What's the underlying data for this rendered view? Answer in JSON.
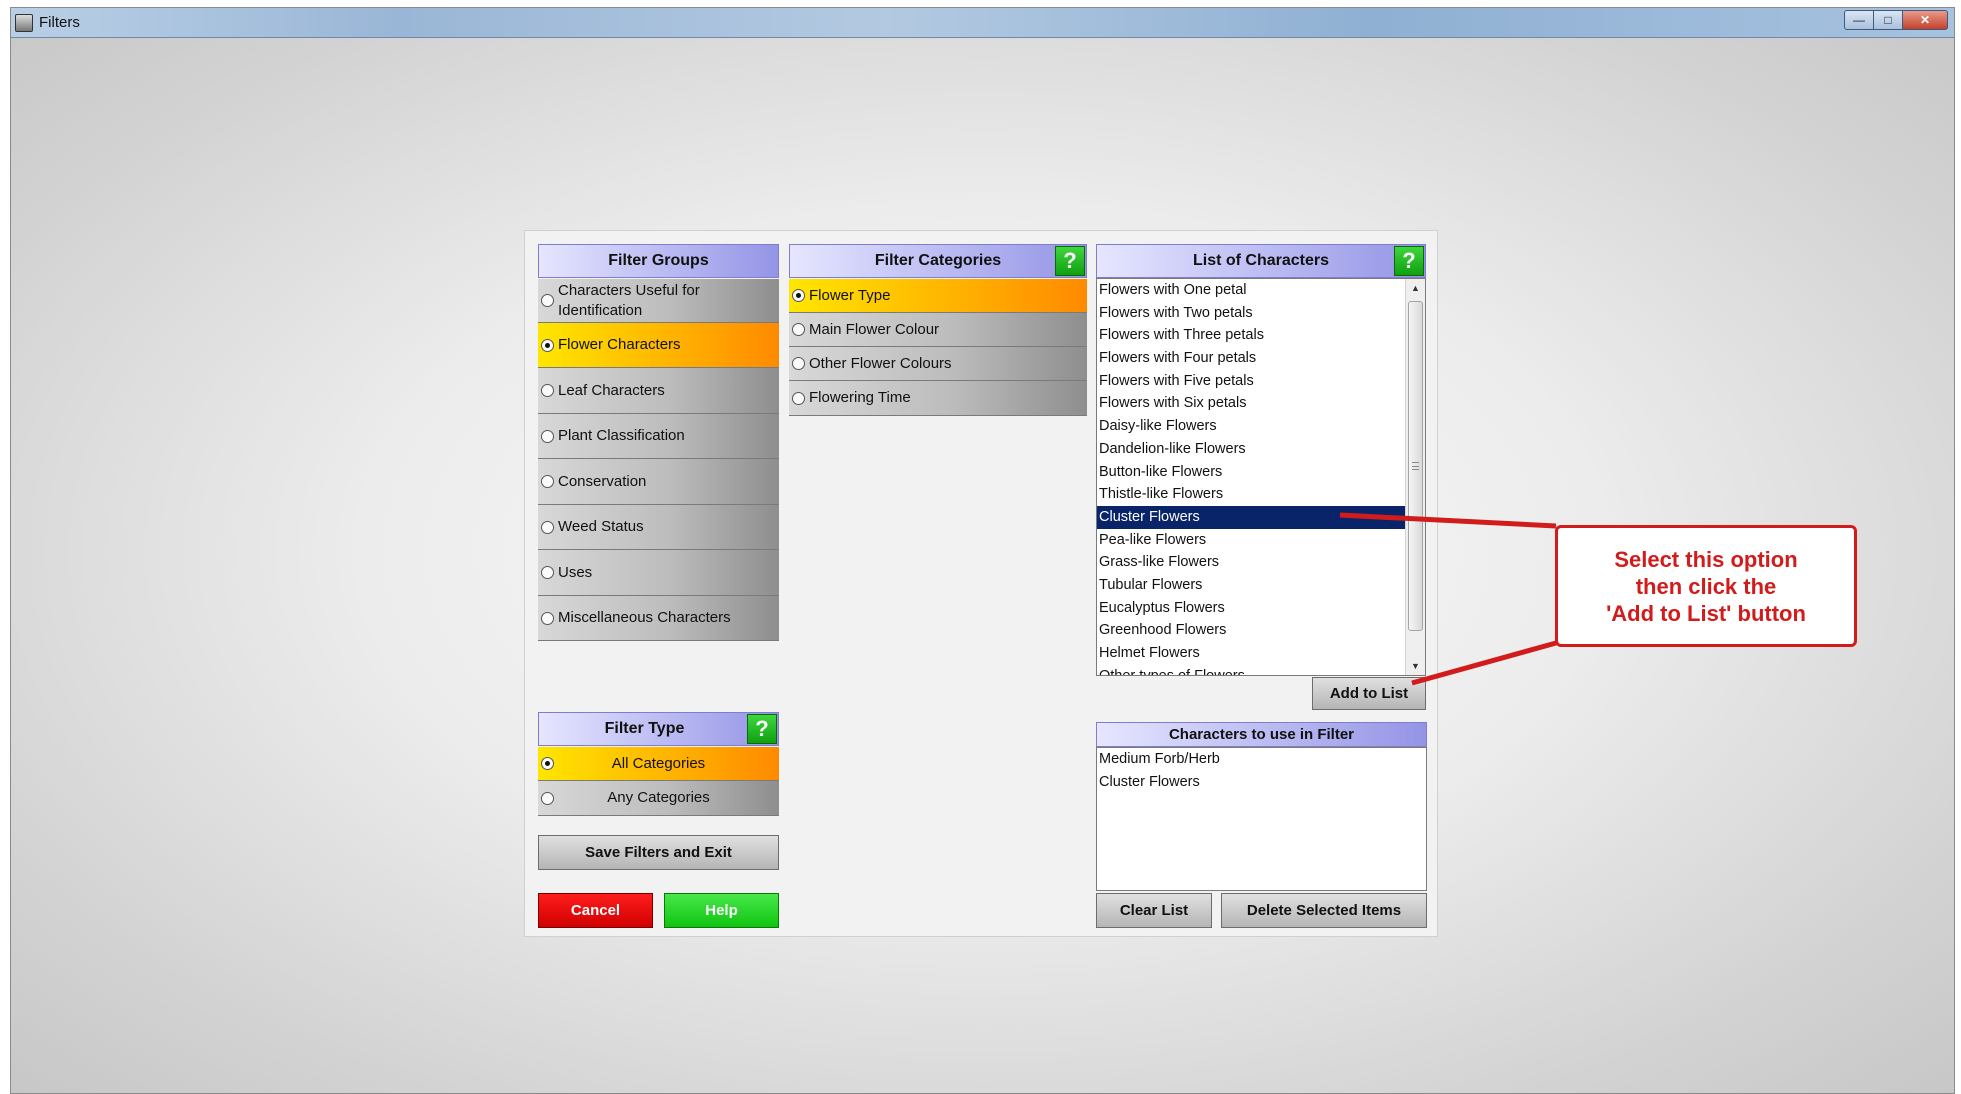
{
  "window": {
    "title": "Filters",
    "controls": [
      "minimize",
      "maximize",
      "close"
    ]
  },
  "filter_groups": {
    "header": "Filter Groups",
    "items": [
      {
        "label": "Characters Useful for Identification",
        "selected": false
      },
      {
        "label": "Flower Characters",
        "selected": true
      },
      {
        "label": "Leaf Characters",
        "selected": false
      },
      {
        "label": "Plant Classification",
        "selected": false
      },
      {
        "label": "Conservation",
        "selected": false
      },
      {
        "label": "Weed Status",
        "selected": false
      },
      {
        "label": "Uses",
        "selected": false
      },
      {
        "label": "Miscellaneous Characters",
        "selected": false
      }
    ]
  },
  "filter_categories": {
    "header": "Filter Categories",
    "help_label": "?",
    "items": [
      {
        "label": "Flower Type",
        "selected": true
      },
      {
        "label": "Main Flower Colour",
        "selected": false
      },
      {
        "label": "Other Flower Colours",
        "selected": false
      },
      {
        "label": "Flowering Time",
        "selected": false
      }
    ]
  },
  "characters": {
    "header": "List of Characters",
    "help_label": "?",
    "items": [
      "Flowers with One petal",
      "Flowers with Two petals",
      "Flowers with Three petals",
      "Flowers with Four petals",
      "Flowers with Five petals",
      "Flowers with Six petals",
      "Daisy-like Flowers",
      "Dandelion-like Flowers",
      "Button-like Flowers",
      "Thistle-like Flowers",
      "Cluster Flowers",
      "Pea-like Flowers",
      "Grass-like Flowers",
      "Tubular Flowers",
      "Eucalyptus Flowers",
      "Greenhood Flowers",
      "Helmet Flowers",
      "Other types of Flowers"
    ],
    "selected_item": "Cluster Flowers",
    "add_button": "Add to List"
  },
  "filter_type": {
    "header": "Filter Type",
    "help_label": "?",
    "items": [
      {
        "label": "All Categories",
        "selected": true
      },
      {
        "label": "Any Categories",
        "selected": false
      }
    ]
  },
  "buttons": {
    "save": "Save Filters and Exit",
    "cancel": "Cancel",
    "help": "Help",
    "clear": "Clear List",
    "delete": "Delete Selected Items"
  },
  "in_filter": {
    "header": "Characters to use in Filter",
    "items": [
      "Medium Forb/Herb",
      "Cluster Flowers"
    ]
  },
  "callout": {
    "line1": "Select this option",
    "line2": "then click the",
    "line3": "'Add to List' button"
  },
  "colors": {
    "selected_row": "#ffb800",
    "list_selection": "#0a246a",
    "callout": "#d21c1c",
    "help_green": "#10a010"
  }
}
